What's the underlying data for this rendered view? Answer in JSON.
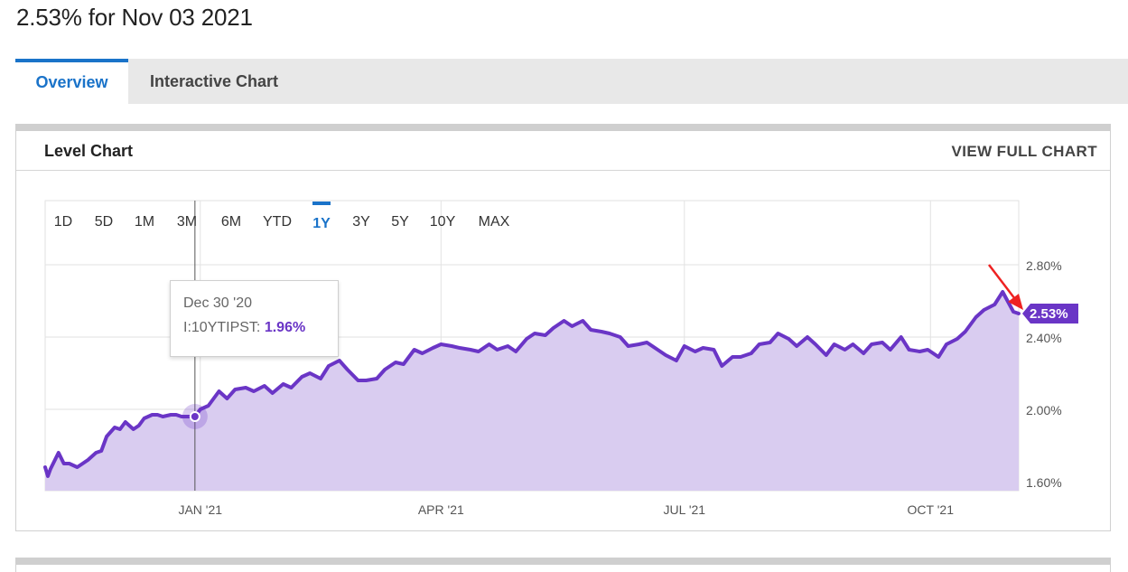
{
  "header": {
    "title": "2.53% for Nov 03 2021"
  },
  "tabs": [
    {
      "label": "Overview",
      "active": true
    },
    {
      "label": "Interactive Chart",
      "active": false
    }
  ],
  "card": {
    "title": "Level Chart",
    "view_full_label": "VIEW FULL CHART"
  },
  "ranges": [
    {
      "label": "1D"
    },
    {
      "label": "5D"
    },
    {
      "label": "1M"
    },
    {
      "label": "3M"
    },
    {
      "label": "6M"
    },
    {
      "label": "YTD"
    },
    {
      "label": "1Y",
      "active": true
    },
    {
      "label": "3Y"
    },
    {
      "label": "5Y"
    },
    {
      "label": "10Y"
    },
    {
      "label": "MAX"
    }
  ],
  "tooltip": {
    "date": "Dec 30 '20",
    "series_label": "I:10YTIPST:",
    "value": "1.96%"
  },
  "colors": {
    "accent": "#1a73c9",
    "line": "#6a35c6",
    "fill": "#d9ccf0",
    "annotation_arrow": "#ee2222"
  },
  "chart_data": {
    "type": "area",
    "title": "",
    "xlabel": "",
    "ylabel": "",
    "ylim": [
      1.6,
      3.0
    ],
    "yticks": [
      1.6,
      2.0,
      2.4,
      2.8
    ],
    "ytick_labels": [
      "1.60%",
      "2.00%",
      "2.40%",
      "2.80%"
    ],
    "xtick_labels": [
      "JAN '21",
      "APR '21",
      "JUL '21",
      "OCT '21"
    ],
    "xticks": [
      "2021-01-01",
      "2021-04-01",
      "2021-07-01",
      "2021-10-01"
    ],
    "grid": true,
    "last_value_label": "2.53%",
    "highlight": {
      "date": "2020-12-30",
      "value": 1.96
    },
    "series": [
      {
        "x": [
          "2020-11-04",
          "2020-11-05",
          "2020-11-06",
          "2020-11-09",
          "2020-11-11",
          "2020-11-13",
          "2020-11-16",
          "2020-11-18",
          "2020-11-20",
          "2020-11-23",
          "2020-11-25",
          "2020-11-27",
          "2020-11-30",
          "2020-12-02",
          "2020-12-04",
          "2020-12-07",
          "2020-12-09",
          "2020-12-11",
          "2020-12-14",
          "2020-12-16",
          "2020-12-18",
          "2020-12-21",
          "2020-12-23",
          "2020-12-25",
          "2020-12-28",
          "2020-12-30",
          "2021-01-01",
          "2021-01-04",
          "2021-01-06",
          "2021-01-08",
          "2021-01-11",
          "2021-01-14",
          "2021-01-18",
          "2021-01-21",
          "2021-01-25",
          "2021-01-28",
          "2021-02-01",
          "2021-02-04",
          "2021-02-08",
          "2021-02-11",
          "2021-02-15",
          "2021-02-18",
          "2021-02-22",
          "2021-02-25",
          "2021-03-01",
          "2021-03-04",
          "2021-03-08",
          "2021-03-11",
          "2021-03-15",
          "2021-03-18",
          "2021-03-22",
          "2021-03-25",
          "2021-03-29",
          "2021-04-01",
          "2021-04-05",
          "2021-04-08",
          "2021-04-12",
          "2021-04-15",
          "2021-04-19",
          "2021-04-22",
          "2021-04-26",
          "2021-04-29",
          "2021-05-03",
          "2021-05-06",
          "2021-05-10",
          "2021-05-13",
          "2021-05-17",
          "2021-05-20",
          "2021-05-24",
          "2021-05-27",
          "2021-05-31",
          "2021-06-03",
          "2021-06-07",
          "2021-06-10",
          "2021-06-14",
          "2021-06-17",
          "2021-06-21",
          "2021-06-24",
          "2021-06-28",
          "2021-07-01",
          "2021-07-05",
          "2021-07-08",
          "2021-07-12",
          "2021-07-15",
          "2021-07-19",
          "2021-07-22",
          "2021-07-26",
          "2021-07-29",
          "2021-08-02",
          "2021-08-05",
          "2021-08-09",
          "2021-08-12",
          "2021-08-16",
          "2021-08-19",
          "2021-08-23",
          "2021-08-26",
          "2021-08-30",
          "2021-09-02",
          "2021-09-06",
          "2021-09-09",
          "2021-09-13",
          "2021-09-16",
          "2021-09-20",
          "2021-09-23",
          "2021-09-27",
          "2021-09-30",
          "2021-10-04",
          "2021-10-07",
          "2021-10-11",
          "2021-10-14",
          "2021-10-18",
          "2021-10-21",
          "2021-10-25",
          "2021-10-28",
          "2021-11-01",
          "2021-11-03"
        ],
        "values": [
          1.68,
          1.63,
          1.67,
          1.76,
          1.7,
          1.7,
          1.68,
          1.7,
          1.72,
          1.76,
          1.77,
          1.85,
          1.9,
          1.89,
          1.93,
          1.89,
          1.91,
          1.95,
          1.97,
          1.97,
          1.96,
          1.97,
          1.97,
          1.96,
          1.96,
          1.96,
          2.0,
          2.02,
          2.06,
          2.1,
          2.06,
          2.11,
          2.12,
          2.1,
          2.13,
          2.09,
          2.14,
          2.12,
          2.18,
          2.2,
          2.17,
          2.24,
          2.27,
          2.22,
          2.16,
          2.16,
          2.17,
          2.22,
          2.26,
          2.25,
          2.33,
          2.31,
          2.34,
          2.36,
          2.35,
          2.34,
          2.33,
          2.32,
          2.36,
          2.33,
          2.35,
          2.32,
          2.39,
          2.42,
          2.41,
          2.45,
          2.49,
          2.46,
          2.49,
          2.44,
          2.43,
          2.42,
          2.4,
          2.35,
          2.36,
          2.37,
          2.33,
          2.3,
          2.27,
          2.35,
          2.32,
          2.34,
          2.33,
          2.24,
          2.29,
          2.29,
          2.31,
          2.36,
          2.37,
          2.42,
          2.39,
          2.35,
          2.4,
          2.36,
          2.3,
          2.36,
          2.33,
          2.36,
          2.31,
          2.36,
          2.37,
          2.33,
          2.4,
          2.33,
          2.32,
          2.33,
          2.29,
          2.36,
          2.39,
          2.43,
          2.51,
          2.55,
          2.58,
          2.65,
          2.54,
          2.53
        ]
      }
    ]
  }
}
